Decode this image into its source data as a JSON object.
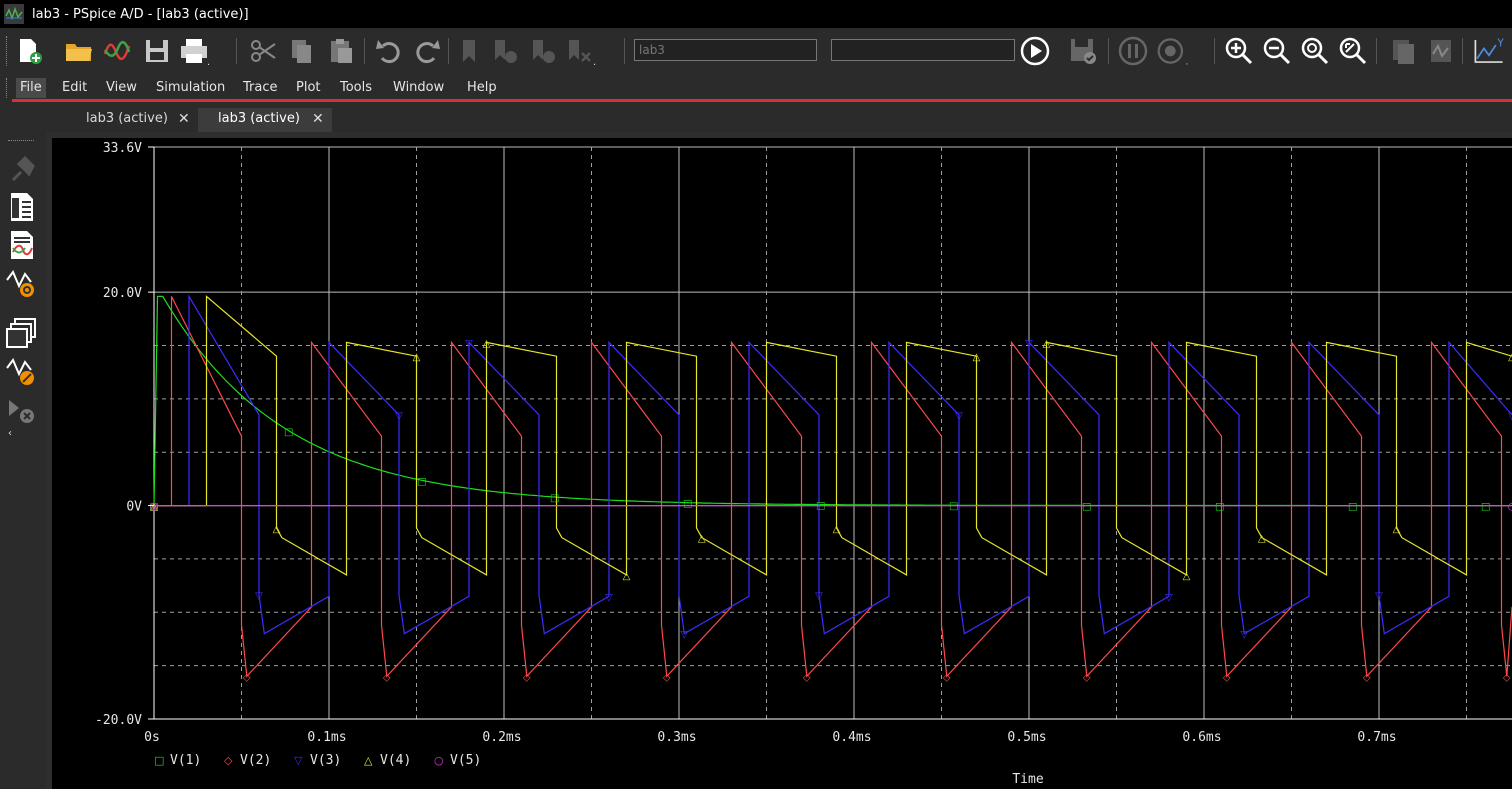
{
  "window": {
    "title": "lab3 - PSpice A/D  - [lab3 (active)]"
  },
  "toolbar": {
    "profile_value": "lab3",
    "icons": [
      "new-document-icon",
      "open-folder-icon",
      "waveform-icon",
      "save-icon",
      "print-icon",
      "cut-icon",
      "copy-icon",
      "paste-icon",
      "undo-icon",
      "redo-icon",
      "bookmark-icon",
      "bookmark-next-icon",
      "bookmark-prev-icon",
      "bookmark-clear-icon",
      "run-icon",
      "save-check-icon",
      "pause-icon",
      "stop-icon",
      "zoom-in-icon",
      "zoom-out-icon",
      "zoom-area-icon",
      "zoom-fit-icon",
      "copy-plot-icon",
      "add-plot-icon",
      "axis-icon"
    ]
  },
  "menu": {
    "items": [
      "File",
      "Edit",
      "View",
      "Simulation",
      "Trace",
      "Plot",
      "Tools",
      "Window",
      "Help"
    ]
  },
  "tabs": [
    {
      "label": "lab3 (active)",
      "close": "✕"
    },
    {
      "label": "lab3 (active)",
      "close": "✕"
    }
  ],
  "sidebar": {
    "icons": [
      "pin-marker-icon",
      "simulation-profile-icon",
      "output-file-icon",
      "trace-probe-icon",
      "window-cascade-icon",
      "cursor-icon",
      "delete-markers-icon"
    ]
  },
  "plot_labels": {
    "y_ticks": [
      "33.6V",
      "20.0V",
      "0V",
      "-20.0V"
    ],
    "x_ticks": [
      "0s",
      "0.1ms",
      "0.2ms",
      "0.3ms",
      "0.4ms",
      "0.5ms",
      "0.6ms",
      "0.7ms"
    ],
    "xlabel": "Time"
  },
  "chart_data": {
    "type": "line",
    "xlabel": "Time",
    "ylabel": "",
    "x_unit": "ms",
    "xlim": [
      0,
      0.77
    ],
    "ylim": [
      -20,
      33.6
    ],
    "grid": true,
    "legend_placement": "bottom-left",
    "series": [
      {
        "name": "V(1)",
        "color": "#19e019",
        "marker": "□",
        "kind": "decay",
        "peak": 19.6,
        "tau_ms": 0.07
      },
      {
        "name": "V(2)",
        "color": "#ff4a4a",
        "marker": "◇",
        "kind": "square",
        "high_start": 19.6,
        "high_end": 6.5,
        "low_start": -9.5,
        "low_end": -16.0,
        "rise_ms": 0.01,
        "fall_ms": 0.07,
        "period_ms": 0.08
      },
      {
        "name": "V(3)",
        "color": "#3c2cff",
        "marker": "▽",
        "kind": "square",
        "high_start": 19.6,
        "high_end": 8.5,
        "low_start": -8.5,
        "low_end": -12.0,
        "rise_ms": 0.02,
        "fall_ms": 0.06,
        "period_ms": 0.08
      },
      {
        "name": "V(4)",
        "color": "#e6e62a",
        "marker": "△",
        "kind": "square",
        "high_start": 19.6,
        "high_end": 14.0,
        "low_start": -6.5,
        "low_end": -3.0,
        "rise_ms": 0.03,
        "fall_ms": 0.05,
        "period_ms": 0.08
      },
      {
        "name": "V(5)",
        "color": "#e040e0",
        "marker": "○",
        "kind": "zero",
        "value": 0
      }
    ]
  }
}
